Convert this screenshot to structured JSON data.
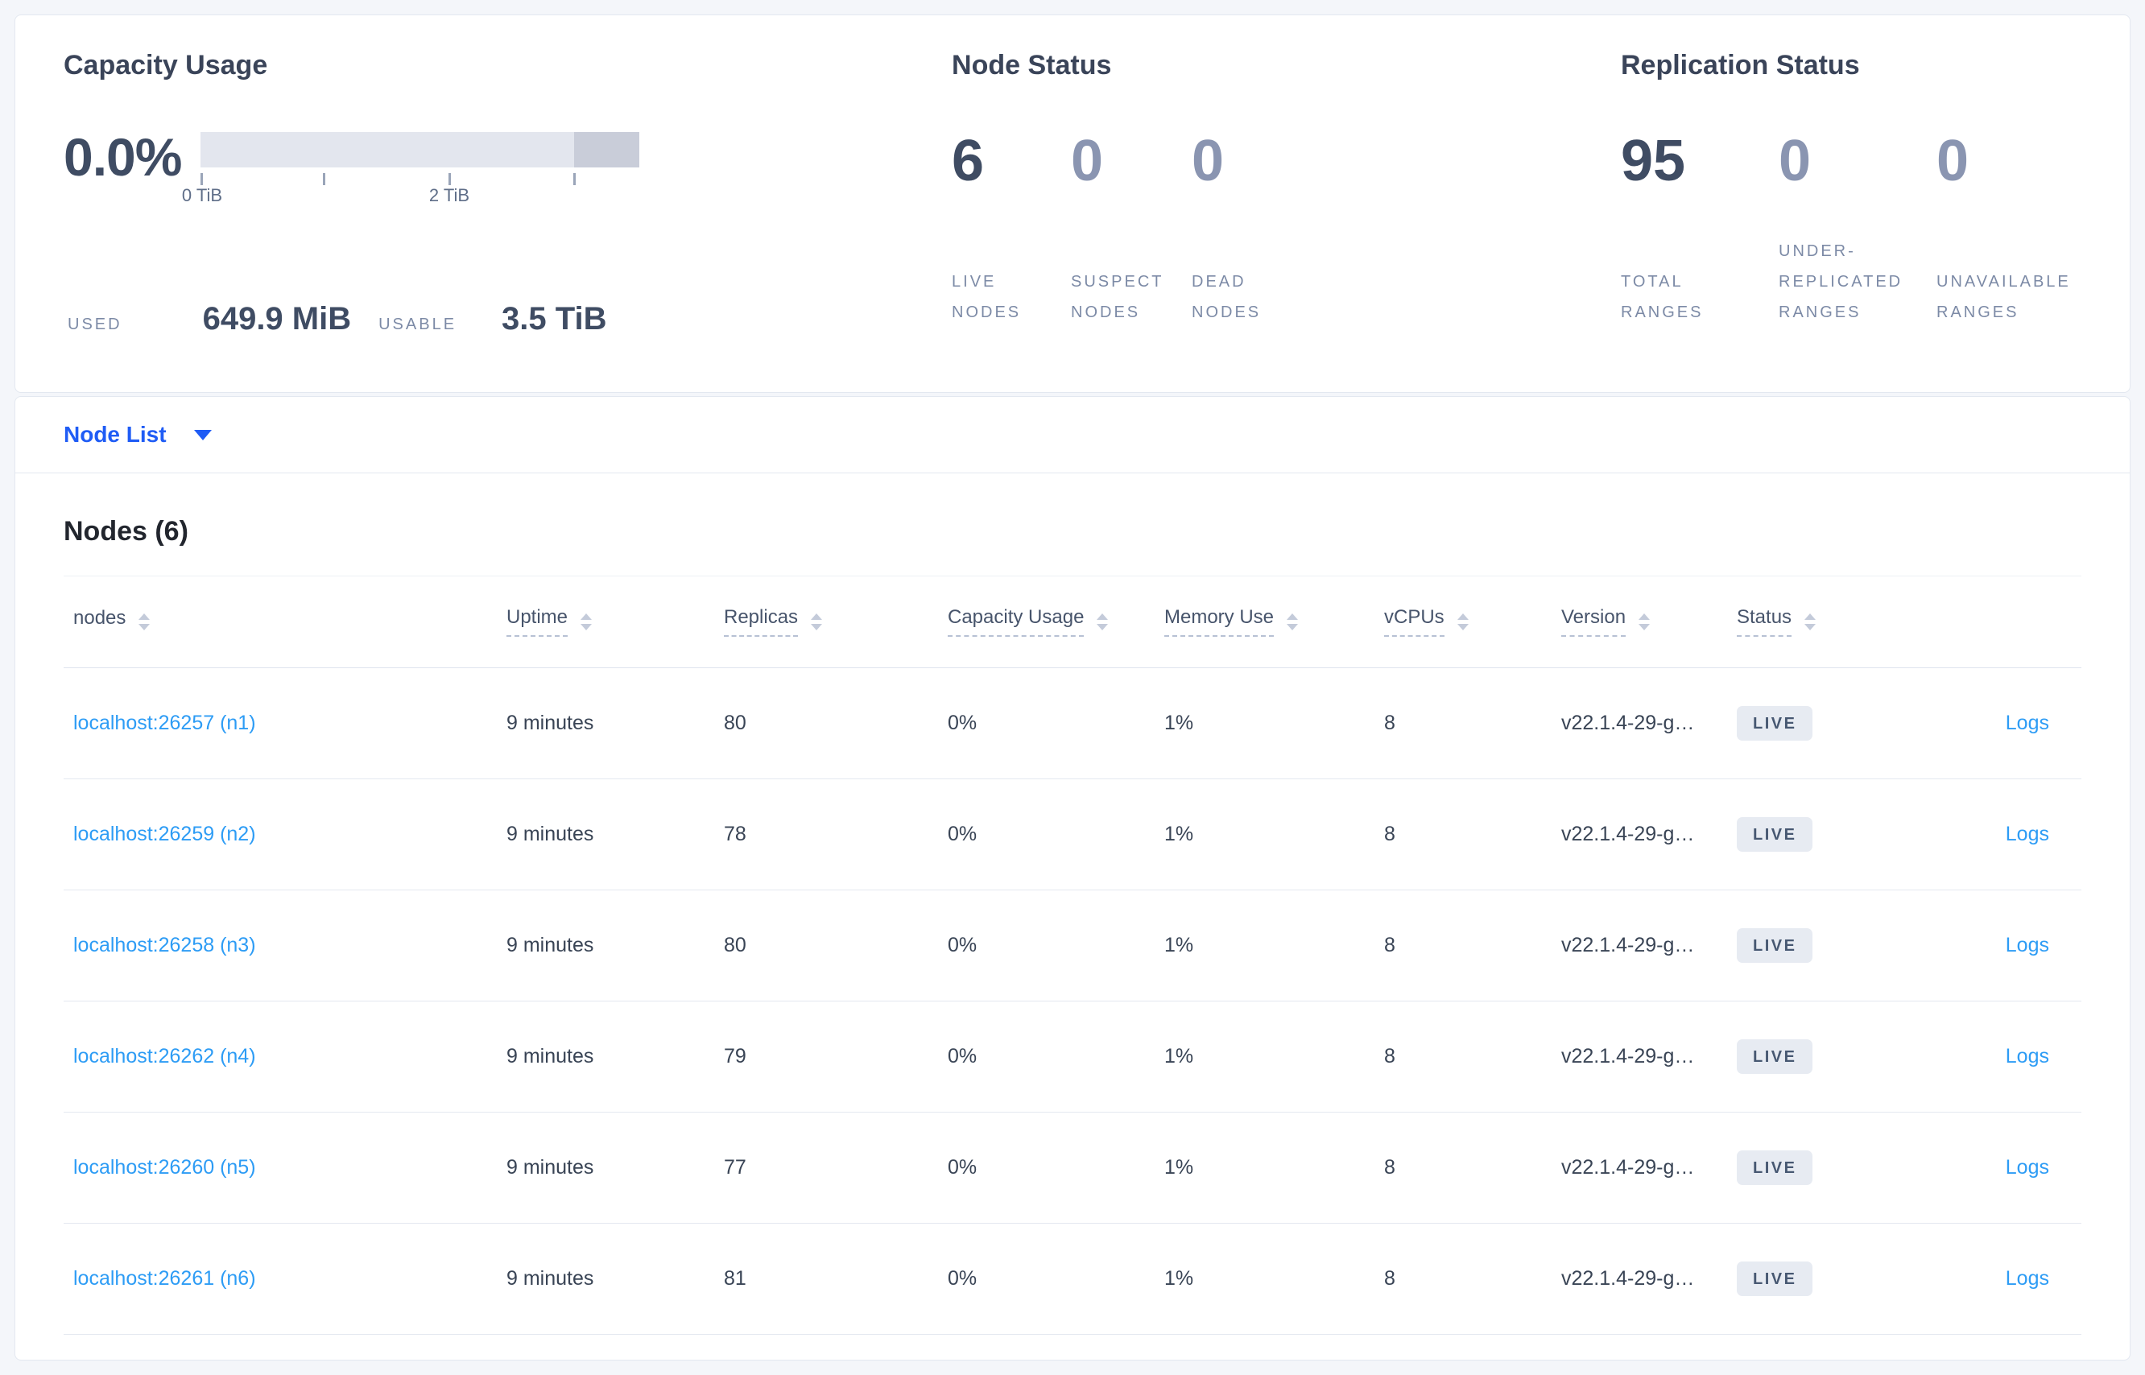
{
  "colors": {
    "page_bg": "#f4f6fa",
    "card_border": "#e3e8f0",
    "primary_link_blue": "#1f5cf5",
    "row_link_blue": "#2d9cf5",
    "dark_number": "#3f4c63",
    "muted_number": "#8a95b1",
    "muted_caps_label": "#7c8aa6",
    "badge_bg": "#e7ebf2",
    "badge_text": "#475872",
    "bar_light": "#e3e6ee",
    "bar_dark": "#c9cdd9"
  },
  "capacity_card": {
    "title": "Capacity Usage",
    "percent_used": "0.0%",
    "axis_ticks": {
      "t0": "0 TiB",
      "t2": "2 TiB"
    },
    "used_label": "USED",
    "used_value": "649.9 MiB",
    "usable_label": "USABLE",
    "usable_value": "3.5 TiB"
  },
  "node_status_card": {
    "title": "Node Status",
    "stats": [
      {
        "value": "6",
        "label": "LIVE\nNODES"
      },
      {
        "value": "0",
        "label": "SUSPECT\nNODES"
      },
      {
        "value": "0",
        "label": "DEAD\nNODES"
      }
    ]
  },
  "replication_card": {
    "title": "Replication Status",
    "stats": [
      {
        "value": "95",
        "label": "TOTAL\nRANGES"
      },
      {
        "value": "0",
        "label": "UNDER-\nREPLICATED\nRANGES"
      },
      {
        "value": "0",
        "label": "UNAVAILABLE\nRANGES"
      }
    ]
  },
  "node_list_selector": {
    "label": "Node List"
  },
  "nodes_table": {
    "title": "Nodes (6)",
    "columns": {
      "nodes": "nodes",
      "uptime": "Uptime",
      "replicas": "Replicas",
      "capacity_usage": "Capacity Usage",
      "memory_use": "Memory Use",
      "vcpus": "vCPUs",
      "version": "Version",
      "status": "Status"
    },
    "logs_label": "Logs",
    "rows": [
      {
        "address": "localhost:26257 (n1)",
        "uptime": "9 minutes",
        "replicas": "80",
        "capacity_usage": "0%",
        "memory_use": "1%",
        "vcpus": "8",
        "version": "v22.1.4-29-g…",
        "status": "LIVE"
      },
      {
        "address": "localhost:26259 (n2)",
        "uptime": "9 minutes",
        "replicas": "78",
        "capacity_usage": "0%",
        "memory_use": "1%",
        "vcpus": "8",
        "version": "v22.1.4-29-g…",
        "status": "LIVE"
      },
      {
        "address": "localhost:26258 (n3)",
        "uptime": "9 minutes",
        "replicas": "80",
        "capacity_usage": "0%",
        "memory_use": "1%",
        "vcpus": "8",
        "version": "v22.1.4-29-g…",
        "status": "LIVE"
      },
      {
        "address": "localhost:26262 (n4)",
        "uptime": "9 minutes",
        "replicas": "79",
        "capacity_usage": "0%",
        "memory_use": "1%",
        "vcpus": "8",
        "version": "v22.1.4-29-g…",
        "status": "LIVE"
      },
      {
        "address": "localhost:26260 (n5)",
        "uptime": "9 minutes",
        "replicas": "77",
        "capacity_usage": "0%",
        "memory_use": "1%",
        "vcpus": "8",
        "version": "v22.1.4-29-g…",
        "status": "LIVE"
      },
      {
        "address": "localhost:26261 (n6)",
        "uptime": "9 minutes",
        "replicas": "81",
        "capacity_usage": "0%",
        "memory_use": "1%",
        "vcpus": "8",
        "version": "v22.1.4-29-g…",
        "status": "LIVE"
      }
    ]
  }
}
